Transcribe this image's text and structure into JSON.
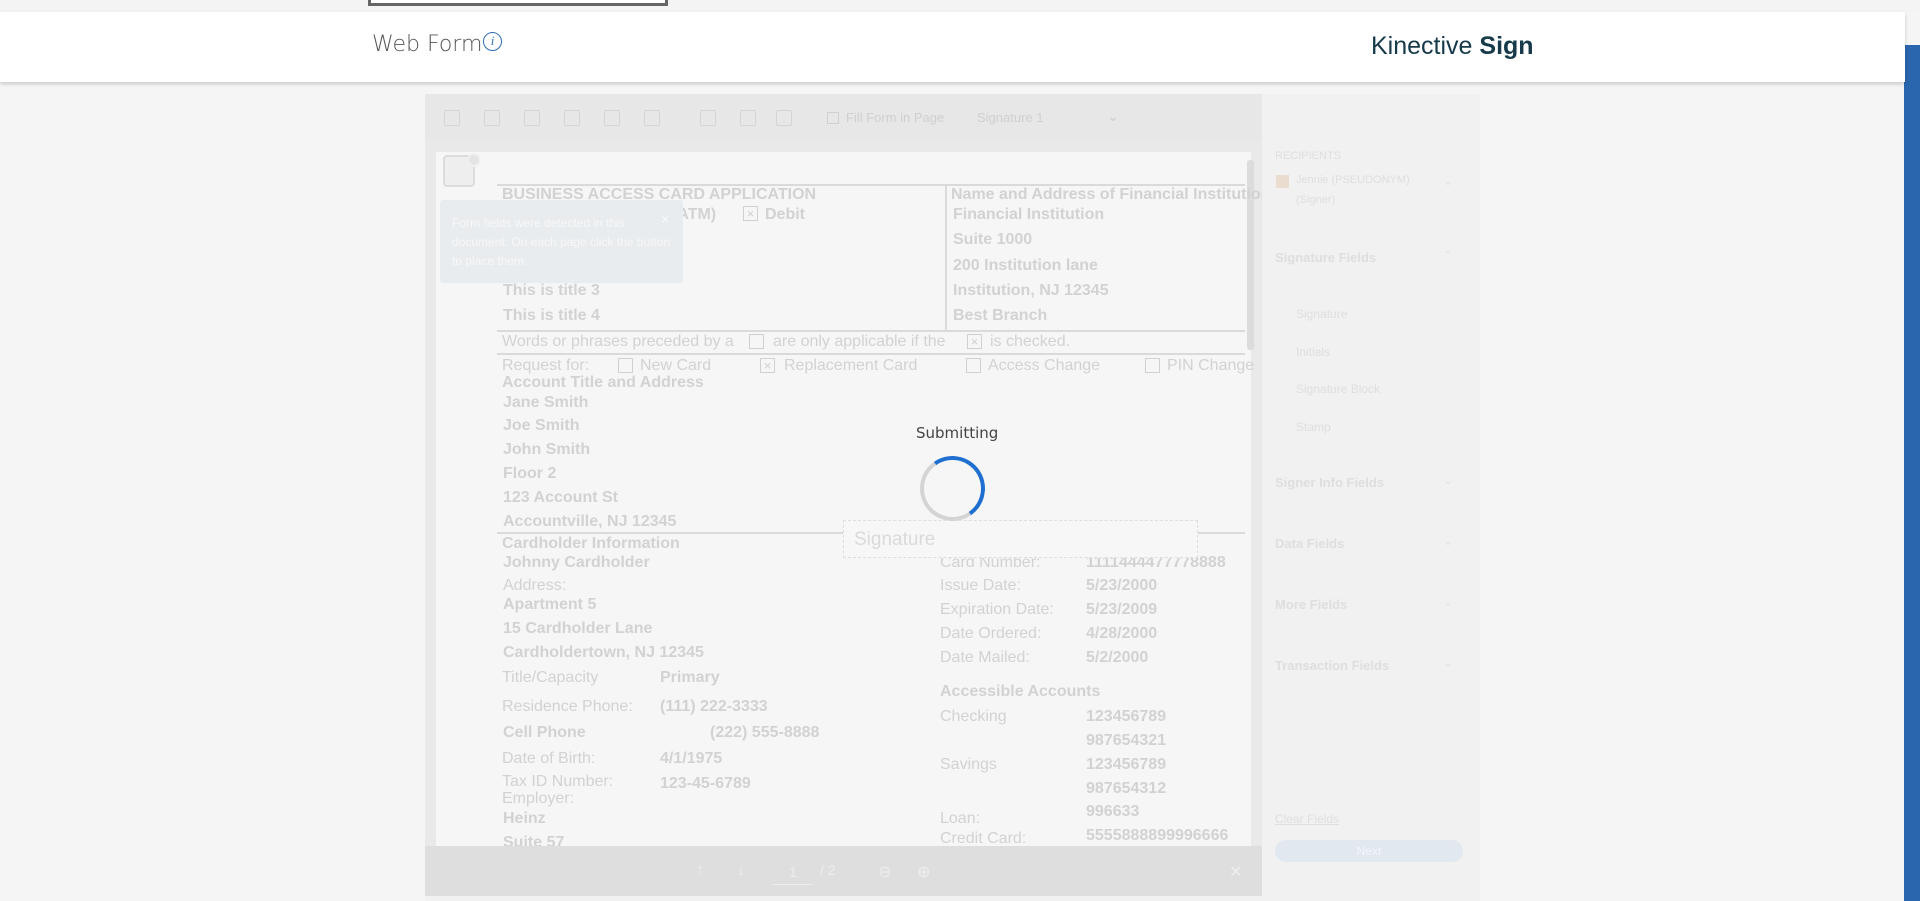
{
  "header": {
    "title": "Web Form",
    "info_icon": "i",
    "brand_regular": "Kinective",
    "brand_bold": "Sign"
  },
  "toolbar": {
    "checkbox_label": "Fill Form in Page",
    "dropdown_value": "Signature 1",
    "dropdown_icon": "chevron-down-icon"
  },
  "tooltip": {
    "text": "Form fields were detected in this document. On each page click the button to place them.",
    "close": "×"
  },
  "document": {
    "title": "BUSINESS ACCESS CARD APPLICATION",
    "atm_label": "(ATM)",
    "debit_label": "Debit",
    "title3": "This is title 3",
    "title4": "This is title 4",
    "fi_header": "Name and Address of Financial Institution",
    "fi_name": "Financial Institution",
    "fi_suite": "Suite 1000",
    "fi_street": "200 Institution lane",
    "fi_city": "Institution, NJ 12345",
    "fi_branch": "Best Branch",
    "words_note_a": "Words or phrases preceded by a",
    "words_note_b": "are only applicable if the",
    "words_note_c": "is checked.",
    "request_for": "Request for:",
    "new_card": "New Card",
    "replacement_card": "Replacement Card",
    "access_change": "Access Change",
    "pin_change": "PIN Change",
    "account_header": "Account Title and Address",
    "account_lines": [
      "Jane Smith",
      "Joe Smith",
      "John Smith",
      "Floor 2",
      "123 Account St",
      "Accountville, NJ 12345"
    ],
    "cardholder_header": "Cardholder Information",
    "cardholder_name": "Johnny Cardholder",
    "address_label": "Address:",
    "address_lines": [
      "Apartment 5",
      "15 Cardholder Lane",
      "Cardholdertown, NJ 12345"
    ],
    "title_capacity_label": "Title/Capacity",
    "title_capacity_value": "Primary",
    "res_phone_label": "Residence Phone:",
    "res_phone_value": "(111) 222-3333",
    "cell_phone_label": "Cell Phone",
    "cell_phone_value": "(222) 555-8888",
    "dob_label": "Date of Birth:",
    "dob_value": "4/1/1975",
    "taxid_label": "Tax ID Number:",
    "taxid_value": "123-45-6789",
    "employer_label": "Employer:",
    "employer_value": "Heinz",
    "employer_suite": "Suite 57",
    "card_number_label": "Card Number:",
    "card_number_value": "1111444477778888",
    "issue_date_label": "Issue Date:",
    "issue_date_value": "5/23/2000",
    "exp_date_label": "Expiration Date:",
    "exp_date_value": "5/23/2009",
    "date_ordered_label": "Date Ordered:",
    "date_ordered_value": "4/28/2000",
    "date_mailed_label": "Date Mailed:",
    "date_mailed_value": "5/2/2000",
    "accessible_header": "Accessible Accounts",
    "checking_label": "Checking",
    "checking_values": [
      "123456789",
      "987654321"
    ],
    "savings_label": "Savings",
    "savings_values": [
      "123456789",
      "987654312"
    ],
    "loan_label": "Loan:",
    "loan_value": "996633",
    "credit_card_label": "Credit Card:",
    "credit_card_value": "5555888899996666",
    "signature_placeholder": "Signature"
  },
  "pager": {
    "prev_icon": "arrow-up-icon",
    "next_icon": "arrow-down-icon",
    "current_page": "1",
    "total_pages": "/ 2",
    "zoom_out_icon": "zoom-out-icon",
    "zoom_in_icon": "zoom-in-icon",
    "close_icon": "close-icon"
  },
  "side_panel": {
    "recipients_header": "RECIPIENTS",
    "recipient_name": "Jennie (PSEUDONYM)",
    "recipient_role": "(Signer)",
    "signature_fields_header": "Signature Fields",
    "signature_fields": [
      "Signature",
      "Initials",
      "Signature Block",
      "Stamp"
    ],
    "signer_info_header": "Signer Info Fields",
    "data_fields_header": "Data Fields",
    "more_fields_header": "More Fields",
    "transaction_fields_header": "Transaction Fields",
    "clear_fields_link": "Clear Fields",
    "next_button": "Next"
  },
  "overlay": {
    "status_text": "Submitting"
  },
  "colors": {
    "brand": "#163a4a",
    "accent": "#1f6fd1",
    "scrollbar": "#2a66ad"
  }
}
